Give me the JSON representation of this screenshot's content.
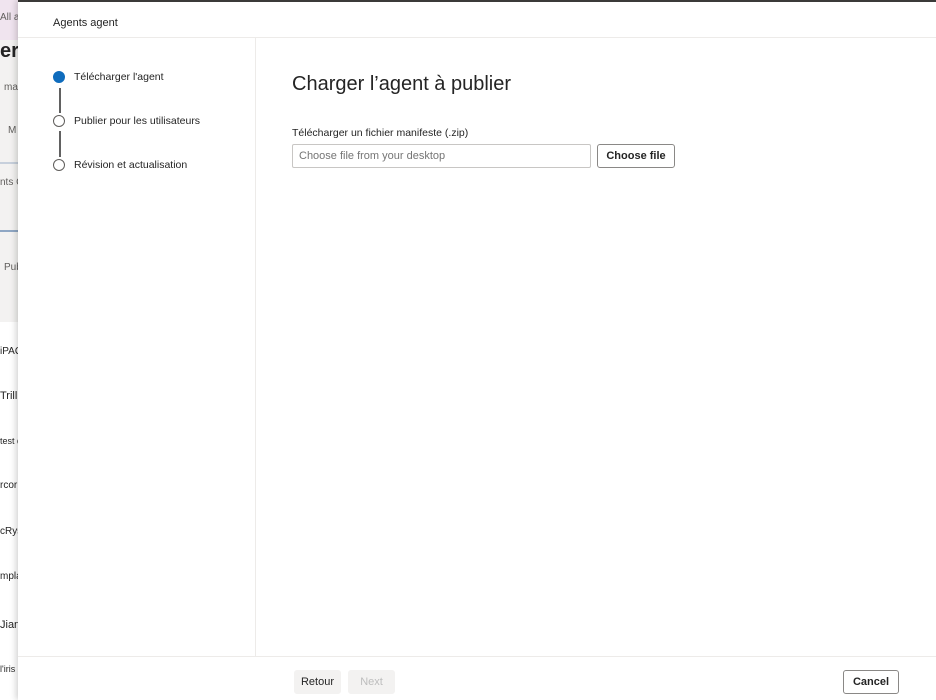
{
  "background": {
    "items": [
      "All ac",
      "er",
      "ma",
      "M",
      "nts C",
      "Pub",
      "iPAQ",
      "Trill",
      "test de",
      "rcor",
      "cRys",
      "mpla",
      "Jian",
      "l'iris"
    ]
  },
  "panel": {
    "title": "Agents agent"
  },
  "steps": [
    {
      "label": "Télécharger l'agent",
      "state": "active"
    },
    {
      "label": "Publier pour les utilisateurs",
      "state": "pending"
    },
    {
      "label": "Révision et actualisation",
      "state": "pending"
    }
  ],
  "main": {
    "heading": "Charger l’agent à publier",
    "field_label": "Télécharger un fichier manifeste (.zip)",
    "file_placeholder": "Choose file from your desktop",
    "choose_button": "Choose file"
  },
  "footer": {
    "back_label": "Retour",
    "next_label": "Next",
    "cancel_label": "Cancel"
  },
  "colors": {
    "accent": "#0f6cbd",
    "border": "#c8c6c4"
  }
}
